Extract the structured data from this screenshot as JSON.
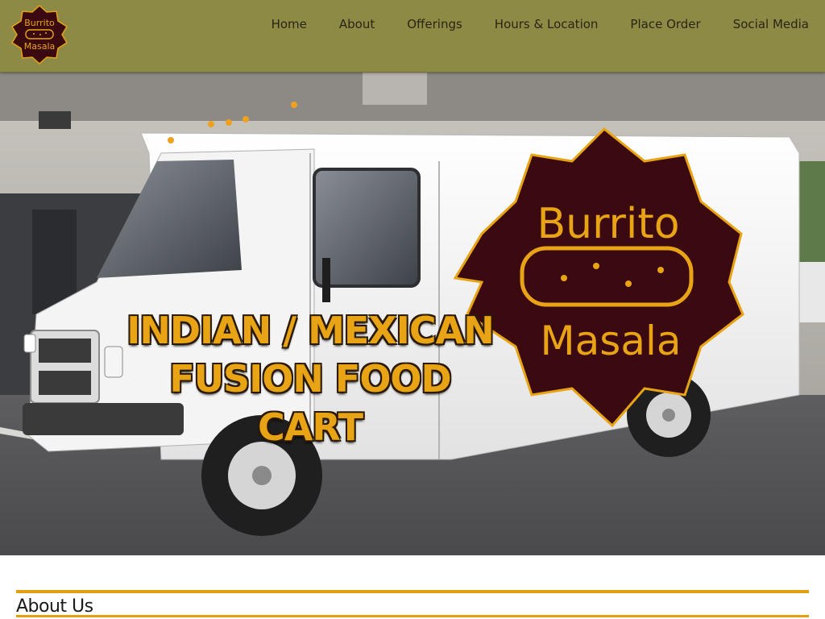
{
  "brand": {
    "logo_line1": "Burrito",
    "logo_line2": "Masala",
    "colors": {
      "nav_bg": "#8c8a45",
      "accent": "#e0a010",
      "logo_bg": "#3a0a10",
      "logo_text": "#e8a414"
    }
  },
  "nav": {
    "items": [
      {
        "label": "Home"
      },
      {
        "label": "About"
      },
      {
        "label": "Offerings"
      },
      {
        "label": "Hours & Location"
      },
      {
        "label": "Place Order"
      },
      {
        "label": "Social Media"
      }
    ]
  },
  "hero": {
    "title_line1": "INDIAN / MEXICAN",
    "title_line2": "FUSION FOOD CART",
    "truck_logo_line1": "Burrito",
    "truck_logo_line2": "Masala"
  },
  "about": {
    "heading": "About Us"
  }
}
